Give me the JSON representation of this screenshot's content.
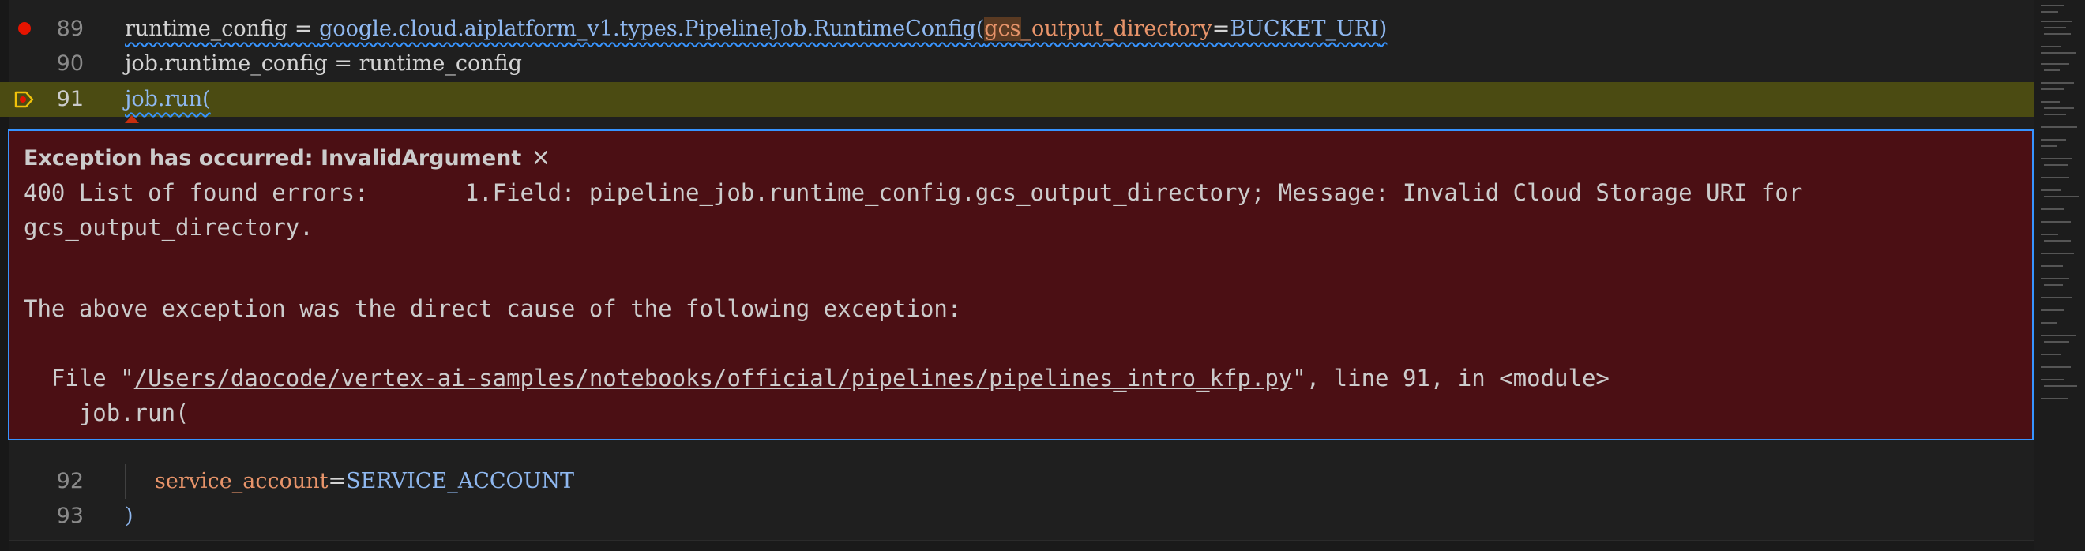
{
  "editor": {
    "lines": [
      {
        "number": "89",
        "tokens": {
          "a": "runtime_config",
          "b": " = ",
          "c": "google.cloud.aiplatform_v1.types.PipelineJob.RuntimeConfig(",
          "d": "gcs",
          "e": "_output_directory",
          "f": "=",
          "g": "BUCKET_URI",
          "h": ")"
        }
      },
      {
        "number": "90",
        "tokens": {
          "a": "job.runtime_config",
          "b": " = ",
          "c": "runtime_config"
        }
      },
      {
        "number": "91",
        "tokens": {
          "a": "job.run("
        }
      },
      {
        "number": "92",
        "tokens": {
          "a": "service_account",
          "b": "=",
          "c": "SERVICE_ACCOUNT"
        }
      },
      {
        "number": "93",
        "tokens": {
          "a": ")"
        }
      }
    ]
  },
  "exception": {
    "title": "Exception has occurred: InvalidArgument",
    "close_glyph": "×",
    "line1": "400 List of found errors:\t1.Field: pipeline_job.runtime_config.gcs_output_directory; Message: Invalid Cloud Storage URI for",
    "line2": "gcs_output_directory.",
    "line3": "The above exception was the direct cause of the following exception:",
    "file_prefix": "  File \"",
    "file_path": "/Users/daocode/vertex-ai-samples/notebooks/official/pipelines/pipelines_intro_kfp.py",
    "file_suffix": "\", line 91, in <module>",
    "code_line": "    job.run("
  },
  "colors": {
    "breakpoint": "#e51400",
    "current_line_bg": "#4b4b12",
    "exception_bg": "#4b0f14",
    "exception_border": "#3794ff"
  },
  "icons": {
    "breakpoint": "breakpoint-dot-icon",
    "current_frame": "current-frame-breakpoint-icon",
    "close": "close-icon"
  }
}
